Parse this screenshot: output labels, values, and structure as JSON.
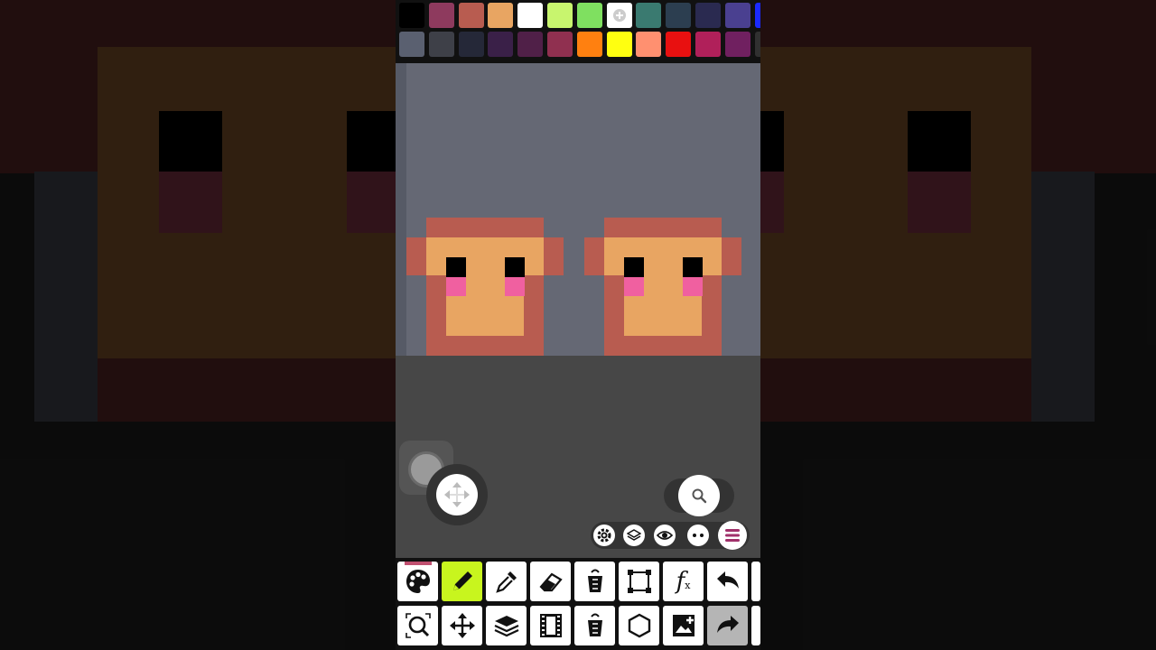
{
  "palette": {
    "row1": [
      "#000000",
      "#8e3a5e",
      "#b85c50",
      "#e8a562",
      "#ffffff",
      "#c8f56e",
      "#7fe060",
      "add",
      "#3a7a70",
      "#2c3e50",
      "#2a2a50",
      "#4a4090",
      "#1a2aff"
    ],
    "row2": [
      "#5a6070",
      "#3e4048",
      "#252838",
      "#3a2048",
      "#502048",
      "#903050",
      "#ff8010",
      "#ffff10",
      "#ff9070",
      "#e81010",
      "#b0205a",
      "#702060",
      "#303030"
    ],
    "add_icon": "plus-circle-icon"
  },
  "colors": {
    "canvas_bg": "#656874",
    "skin": "#e8a562",
    "outline": "#b85c50",
    "eye": "#000000",
    "blush": "#f060a0",
    "accent_active": "#c8f51e",
    "menu_accent": "#a0306a"
  },
  "toolbar": {
    "row1": [
      {
        "name": "palette-tool",
        "icon": "palette-icon"
      },
      {
        "name": "pencil-tool",
        "icon": "pencil-icon",
        "active": true
      },
      {
        "name": "eyedropper-tool",
        "icon": "eyedropper-icon"
      },
      {
        "name": "eraser-tool",
        "icon": "eraser-icon"
      },
      {
        "name": "fill-bucket-tool",
        "icon": "bucket-icon"
      },
      {
        "name": "selection-tool",
        "icon": "selection-frame-icon"
      },
      {
        "name": "function-tool",
        "icon": "function-icon",
        "label": "f",
        "sub": "x"
      },
      {
        "name": "undo-button",
        "icon": "undo-icon"
      }
    ],
    "row2": [
      {
        "name": "zoom-tool",
        "icon": "zoom-icon"
      },
      {
        "name": "move-tool",
        "icon": "move-arrows-icon"
      },
      {
        "name": "layers-tool",
        "icon": "layers-icon"
      },
      {
        "name": "frames-tool",
        "icon": "film-icon"
      },
      {
        "name": "fill-tool-2",
        "icon": "bucket-icon"
      },
      {
        "name": "shape-tool",
        "icon": "hexagon-icon"
      },
      {
        "name": "import-image-tool",
        "icon": "image-add-icon"
      },
      {
        "name": "redo-button",
        "icon": "redo-icon",
        "disabled": true
      }
    ]
  },
  "floating": {
    "joystick": "joystick-icon",
    "move": "move-cross-icon",
    "search": "search-icon",
    "mini": [
      "gear-icon",
      "layers-icon",
      "eye-icon",
      "more-dots-icon"
    ],
    "menu": "menu-icon"
  }
}
